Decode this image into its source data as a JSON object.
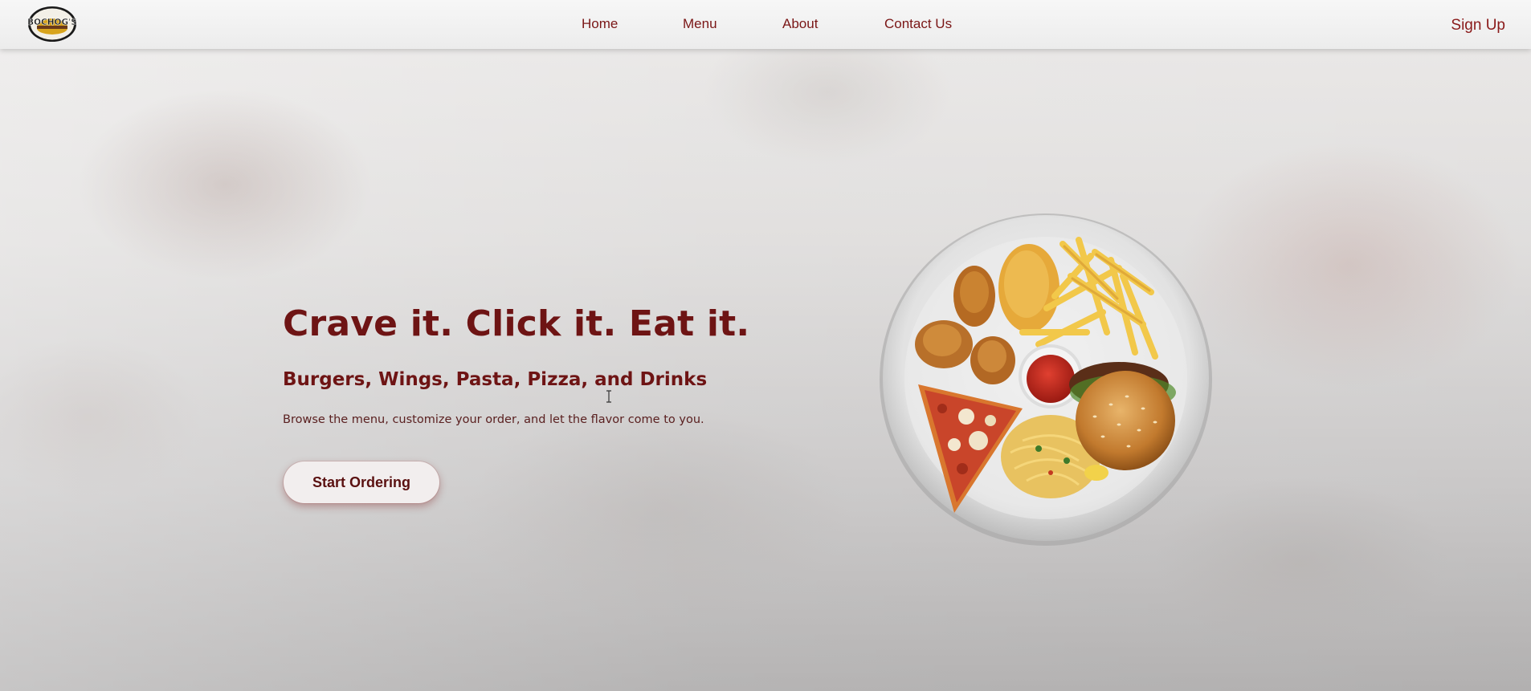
{
  "nav": {
    "logo_text": "BOCHOG'S",
    "links": [
      "Home",
      "Menu",
      "About",
      "Contact Us"
    ],
    "signup_label": "Sign Up"
  },
  "hero": {
    "title": "Crave it. Click it. Eat it.",
    "subtitle": "Burgers, Wings, Pasta, Pizza, and Drinks",
    "description": "Browse the menu, customize your order, and let the flavor come to you.",
    "cta_label": "Start Ordering"
  },
  "colors": {
    "brand_red": "#7a1616",
    "nav_bg": "#f2f2f2",
    "logo_gold": "#d8a41c"
  },
  "icons": {
    "logo": "bochogs-logo",
    "cursor": "text-cursor-icon",
    "food": "food-plate-image"
  }
}
